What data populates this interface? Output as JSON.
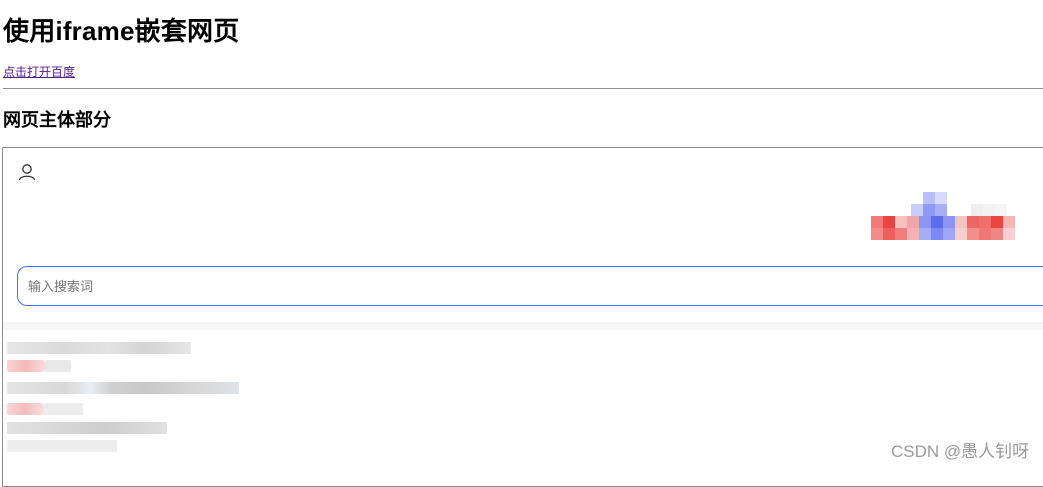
{
  "page": {
    "title": "使用iframe嵌套网页",
    "open_link_label": "点击打开百度",
    "section_title": "网页主体部分"
  },
  "iframe": {
    "user_icon": "user-icon",
    "logo": "baidu-logo",
    "search": {
      "placeholder": "输入搜索词",
      "value": "",
      "border_color": "#4e6ef2"
    },
    "news_items_blurred": 5
  },
  "watermark": {
    "text": "CSDN @愚人钊呀"
  },
  "colors": {
    "link_visited": "#551a8b",
    "logo_red": "#e9443f",
    "logo_blue": "#4e6ef2"
  }
}
